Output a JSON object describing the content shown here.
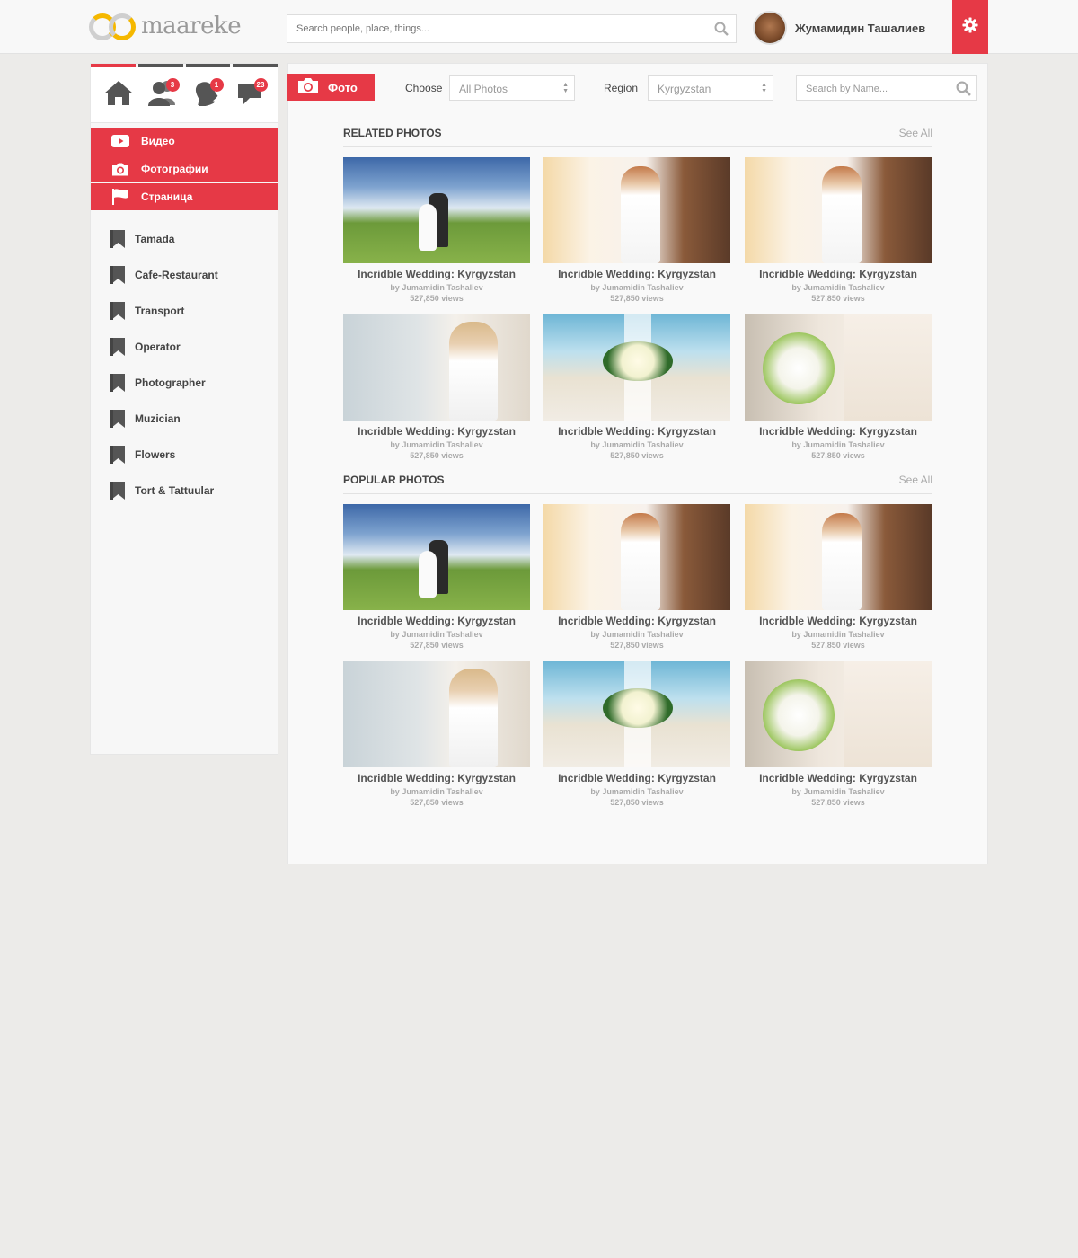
{
  "header": {
    "logo_text": "maareke",
    "search_placeholder": "Search people, place, things...",
    "user_name": "Жумамидин Ташалиев"
  },
  "sidebar": {
    "icons": [
      {
        "name": "home-icon",
        "badge": null
      },
      {
        "name": "friends-icon",
        "badge": "3"
      },
      {
        "name": "notifications-icon",
        "badge": "1"
      },
      {
        "name": "messages-icon",
        "badge": "23"
      }
    ],
    "red_menu": [
      {
        "label": "Видео",
        "icon": "youtube-icon"
      },
      {
        "label": "Фотографии",
        "icon": "camera-icon"
      },
      {
        "label": "Страница",
        "icon": "flag-icon"
      }
    ],
    "categories": [
      "Tamada",
      "Cafe-Restaurant",
      "Transport",
      "Operator",
      "Photographer",
      "Muzician",
      "Flowers",
      "Tort & Tattuular"
    ]
  },
  "toolbar": {
    "section_label": "Фото",
    "choose_label": "Choose",
    "choose_value": "All Photos",
    "region_label": "Region",
    "region_value": "Kyrgyzstan",
    "search_placeholder": "Search by Name..."
  },
  "sections": [
    {
      "title": "RELATED PHOTOS",
      "see_all": "See All",
      "photos": [
        {
          "title": "Incridble Wedding: Kyrgyzstan",
          "by": "by Jumamidin Tashaliev",
          "views": "527,850 views",
          "kind": "field"
        },
        {
          "title": "Incridble Wedding: Kyrgyzstan",
          "by": "by Jumamidin Tashaliev",
          "views": "527,850 views",
          "kind": "street"
        },
        {
          "title": "Incridble Wedding: Kyrgyzstan",
          "by": "by Jumamidin Tashaliev",
          "views": "527,850 views",
          "kind": "street"
        },
        {
          "title": "Incridble Wedding: Kyrgyzstan",
          "by": "by Jumamidin Tashaliev",
          "views": "527,850 views",
          "kind": "bride"
        },
        {
          "title": "Incridble Wedding: Kyrgyzstan",
          "by": "by Jumamidin Tashaliev",
          "views": "527,850 views",
          "kind": "beach"
        },
        {
          "title": "Incridble Wedding: Kyrgyzstan",
          "by": "by Jumamidin Tashaliev",
          "views": "527,850 views",
          "kind": "bouquet"
        }
      ]
    },
    {
      "title": "POPULAR PHOTOS",
      "see_all": "See All",
      "photos": [
        {
          "title": "Incridble Wedding: Kyrgyzstan",
          "by": "by Jumamidin Tashaliev",
          "views": "527,850 views",
          "kind": "field"
        },
        {
          "title": "Incridble Wedding: Kyrgyzstan",
          "by": "by Jumamidin Tashaliev",
          "views": "527,850 views",
          "kind": "street"
        },
        {
          "title": "Incridble Wedding: Kyrgyzstan",
          "by": "by Jumamidin Tashaliev",
          "views": "527,850 views",
          "kind": "street"
        },
        {
          "title": "Incridble Wedding: Kyrgyzstan",
          "by": "by Jumamidin Tashaliev",
          "views": "527,850 views",
          "kind": "bride"
        },
        {
          "title": "Incridble Wedding: Kyrgyzstan",
          "by": "by Jumamidin Tashaliev",
          "views": "527,850 views",
          "kind": "beach"
        },
        {
          "title": "Incridble Wedding: Kyrgyzstan",
          "by": "by Jumamidin Tashaliev",
          "views": "527,850 views",
          "kind": "bouquet"
        }
      ]
    }
  ],
  "colors": {
    "accent": "#e63946",
    "logo_yellow": "#f5b800",
    "icon_dark": "#555555"
  }
}
